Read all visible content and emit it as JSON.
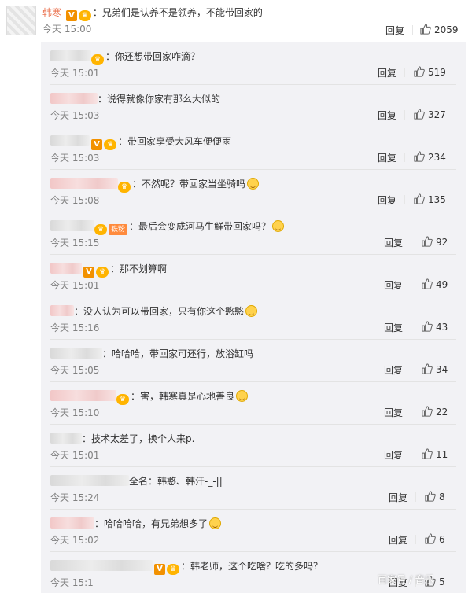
{
  "main_comment": {
    "username": "韩寒",
    "colon": "：",
    "text": "兄弟们是认养不是领养，不能带回家的",
    "time": "今天 15:00",
    "reply_label": "回复",
    "likes": "2059"
  },
  "replies": [
    {
      "colon": "：",
      "text": "你还想带回家咋滴？",
      "time": "今天 15:01",
      "reply_label": "回复",
      "likes": "519"
    },
    {
      "colon": "：",
      "text": "说得就像你家有那么大似的",
      "time": "今天 15:03",
      "reply_label": "回复",
      "likes": "327"
    },
    {
      "colon": "：",
      "text": "带回家享受大风车便便雨",
      "time": "今天 15:03",
      "reply_label": "回复",
      "likes": "234"
    },
    {
      "colon": "：",
      "text": "不然呢？带回家当坐骑吗",
      "time": "今天 15:08",
      "reply_label": "回复",
      "likes": "135"
    },
    {
      "colon": "：",
      "text": "最后会变成河马生鲜带回家吗？",
      "time": "今天 15:15",
      "reply_label": "回复",
      "likes": "92",
      "tag": "铁粉"
    },
    {
      "colon": "：",
      "text": "那不划算啊",
      "time": "今天 15:01",
      "reply_label": "回复",
      "likes": "49"
    },
    {
      "colon": "：",
      "text": "没人认为可以带回家，只有你这个憨憨",
      "time": "今天 15:16",
      "reply_label": "回复",
      "likes": "43"
    },
    {
      "colon": "：",
      "text": "哈哈哈，带回家可还行，放浴缸吗",
      "time": "今天 15:05",
      "reply_label": "回复",
      "likes": "34"
    },
    {
      "colon": "：",
      "text": "害，韩寒真是心地善良",
      "time": "今天 15:10",
      "reply_label": "回复",
      "likes": "22"
    },
    {
      "colon": "：",
      "text": "技术太差了，换个人来p.",
      "time": "今天 15:01",
      "reply_label": "回复",
      "likes": "11"
    },
    {
      "colon": "：",
      "text": "全名：韩憨、韩汗-_-||",
      "time": "今天 15:24",
      "reply_label": "回复",
      "likes": "8"
    },
    {
      "colon": "：",
      "text": "哈哈哈哈，有兄弟想多了",
      "time": "今天 15:02",
      "reply_label": "回复",
      "likes": "6"
    },
    {
      "colon": "：",
      "text": "韩老师，这个吃啥？吃的多吗？",
      "time": "今天 15:1",
      "reply_label": "回复",
      "likes": "5"
    }
  ],
  "badges": {
    "v": "V",
    "crown": "♛"
  },
  "colors": {
    "link": "#eb7350",
    "panel": "#f2f2f5",
    "time": "#808080",
    "v_badge": "#f29100"
  },
  "icons": {
    "like": "thumb-up-icon",
    "emoji": "smile-emoji-icon"
  },
  "watermark": "百家号 / 音乐"
}
